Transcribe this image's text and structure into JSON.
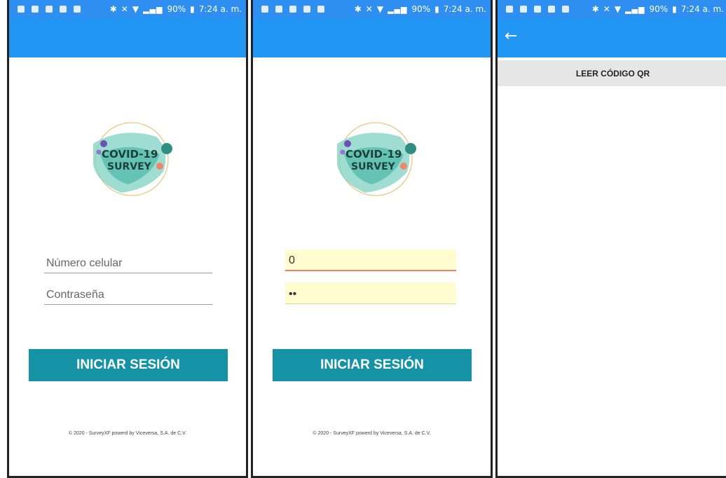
{
  "status_bar": {
    "battery": "90%",
    "time": "7:24 a. m."
  },
  "login_screen_1": {
    "logo_line1": "COVID-19",
    "logo_line2": "SURVEY",
    "phone_placeholder": "Número celular",
    "password_placeholder": "Contraseña",
    "login_button": "INICIAR SESIÓN",
    "footer": "© 2020 - SurveyXF powerd by Viceversa, S.A. de C.V."
  },
  "login_screen_2": {
    "logo_line1": "COVID-19",
    "logo_line2": "SURVEY",
    "phone_value": "0",
    "password_value": "••",
    "login_button": "INICIAR SESIÓN",
    "footer": "© 2020 - SurveyXF powerd by Viceversa, S.A. de C.V."
  },
  "qr_screen": {
    "read_qr_button": "LEER CÓDIGO QR"
  },
  "colors": {
    "appbar": "#2196f3",
    "button": "#1592a6",
    "autofill": "#fffccf"
  }
}
